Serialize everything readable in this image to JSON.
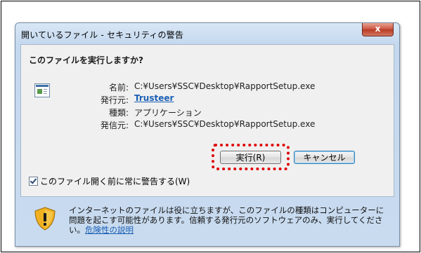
{
  "window": {
    "title": "開いているファイル - セキュリティの警告",
    "close_label": "x"
  },
  "prompt": {
    "question": "このファイルを実行しますか?"
  },
  "file_info": {
    "name_label": "名前:",
    "name_value": "C:¥Users¥SSC¥Desktop¥RapportSetup.exe",
    "publisher_label": "発行元:",
    "publisher_value": "Trusteer",
    "type_label": "種類:",
    "type_value": "アプリケーション",
    "from_label": "発信元:",
    "from_value": "C:¥Users¥SSC¥Desktop¥RapportSetup.exe"
  },
  "buttons": {
    "run_label": "実行(R)",
    "cancel_label": "キャンセル"
  },
  "checkbox": {
    "label": "このファイル開く前に常に警告する(W)",
    "checked": true
  },
  "footer": {
    "warning_text": "インターネットのファイルは役に立ちますが、このファイルの種類はコンピューターに問題を起こす可能性があります。信頼する発行元のソフトウェアのみ、実行してください。",
    "risk_link": "危険性の説明"
  },
  "colors": {
    "highlight": "#e00000",
    "link": "#1a5fb4",
    "shield": "#f0b020"
  }
}
